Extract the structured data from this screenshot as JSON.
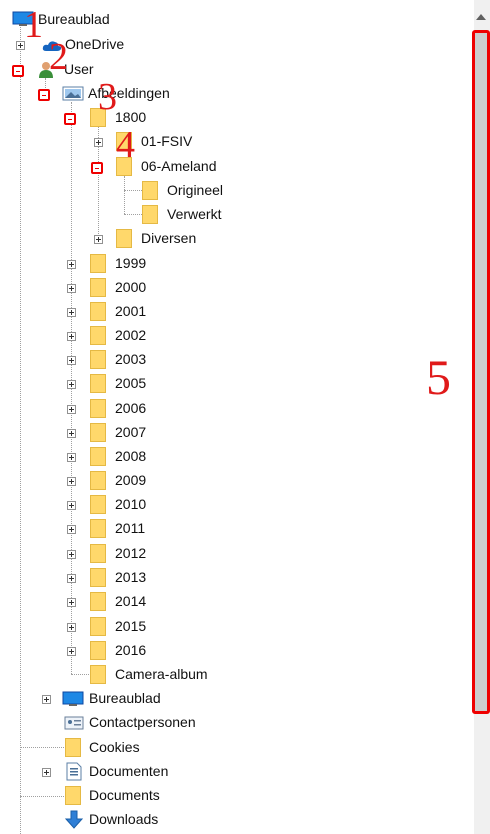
{
  "tree": {
    "root": "Bureaublad",
    "onedrive": "OneDrive",
    "user": "User",
    "afbeeldingen": "Afbeeldingen",
    "y1800": "1800",
    "fsiv": "01-FSIV",
    "ameland": "06-Ameland",
    "origineel": "Origineel",
    "verwerkt": "Verwerkt",
    "diversen": "Diversen",
    "years": [
      "1999",
      "2000",
      "2001",
      "2002",
      "2003",
      "2005",
      "2006",
      "2007",
      "2008",
      "2009",
      "2010",
      "2011",
      "2012",
      "2013",
      "2014",
      "2015",
      "2016"
    ],
    "camera": "Camera-album",
    "bureaublad2": "Bureaublad",
    "contacts": "Contactpersonen",
    "cookies": "Cookies",
    "documenten": "Documenten",
    "documents": "Documents",
    "downloads": "Downloads"
  },
  "annotations": [
    "1",
    "2",
    "3",
    "4",
    "5"
  ],
  "icons": {
    "desktop": "desktop-icon",
    "cloud": "onedrive-cloud-icon",
    "user": "user-icon",
    "pictures": "pictures-library-icon",
    "folder": "folder-icon",
    "contacts": "contacts-icon",
    "document": "document-icon",
    "download": "download-arrow-icon"
  },
  "colors": {
    "annotation": "#e01a1a",
    "folder": "#ffd86b",
    "desktop": "#1e88e5"
  }
}
